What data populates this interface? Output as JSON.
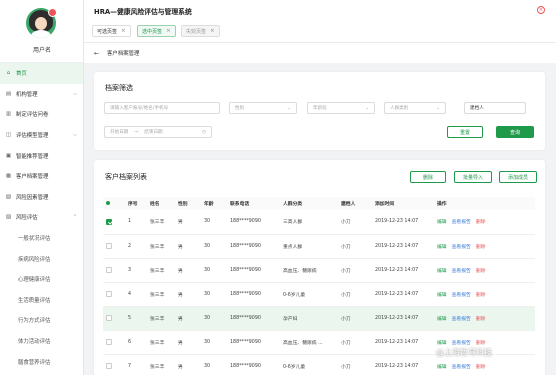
{
  "sidebar": {
    "username": "用户名",
    "menu": [
      {
        "label": "首页",
        "icon": "home-icon",
        "glyph": "⌂",
        "active": true,
        "arrow": ""
      },
      {
        "label": "机构管理",
        "icon": "building-icon",
        "glyph": "▤",
        "active": false,
        "arrow": "⌵"
      },
      {
        "label": "制定评估问卷",
        "icon": "document-icon",
        "glyph": "▥",
        "active": false,
        "arrow": ""
      },
      {
        "label": "评估模型管理",
        "icon": "model-icon",
        "glyph": "◫",
        "active": false,
        "arrow": "⌵"
      },
      {
        "label": "智能推荐管理",
        "icon": "recommend-icon",
        "glyph": "▣",
        "active": false,
        "arrow": ""
      },
      {
        "label": "客户档案管理",
        "icon": "archive-icon",
        "glyph": "▦",
        "active": false,
        "arrow": ""
      },
      {
        "label": "风险因素管理",
        "icon": "risk-factor-icon",
        "glyph": "▧",
        "active": false,
        "arrow": ""
      },
      {
        "label": "风险评估",
        "icon": "risk-assess-icon",
        "glyph": "▨",
        "active": false,
        "arrow": "⌃"
      }
    ],
    "submenu": [
      "一般状况评估",
      "疾病风险评估",
      "心理健康评估",
      "生活质量评估",
      "行为方式评估",
      "体力活动评估",
      "膳食营养评估"
    ]
  },
  "header": {
    "title": "HRA—健康风险评估与管理系统",
    "close_glyph": "×",
    "tabs": [
      {
        "label": "可选页签",
        "state": "normal"
      },
      {
        "label": "选中页签",
        "state": "selected"
      },
      {
        "label": "失效页签",
        "state": "disabled"
      }
    ],
    "tab_close_glyph": "×"
  },
  "breadcrumb": {
    "back_glyph": "←",
    "label": "客户档案管理"
  },
  "filter": {
    "title": "档案筛选",
    "search_placeholder": "请输入客户账号/姓名/手机号",
    "gender_placeholder": "性别",
    "age_placeholder": "年龄段",
    "category_placeholder": "人群类别",
    "creator_value": "建档人",
    "start_placeholder": "开始日期",
    "range_sep": "→",
    "end_placeholder": "结束日期",
    "reset_label": "重置",
    "query_label": "查询",
    "chevron": "⌄",
    "calendar_glyph": "◷"
  },
  "list": {
    "title": "客户档案列表",
    "delete_label": "删除",
    "import_label": "批量导入",
    "add_label": "添加成员",
    "columns": [
      "",
      "序号",
      "姓名",
      "性别",
      "年龄",
      "联系电话",
      "人群分类",
      "建档人",
      "添加时间",
      "操作"
    ],
    "actions": {
      "edit": "编辑",
      "report": "查看报告",
      "delete": "删除"
    },
    "rows": [
      {
        "checked": true,
        "no": "1",
        "name": "张三丰",
        "gender": "男",
        "age": "30",
        "phone": "188****9090",
        "category": "三高人群",
        "creator": "小刀",
        "time": "2019-12-23 14:07",
        "highlight": false
      },
      {
        "checked": false,
        "no": "2",
        "name": "张三丰",
        "gender": "男",
        "age": "30",
        "phone": "188****9090",
        "category": "重点人群",
        "creator": "小刀",
        "time": "2019-12-23 14:07",
        "highlight": false
      },
      {
        "checked": false,
        "no": "3",
        "name": "张三丰",
        "gender": "男",
        "age": "30",
        "phone": "188****9090",
        "category": "高血压、糖尿病",
        "creator": "小刀",
        "time": "2019-12-23 14:07",
        "highlight": false
      },
      {
        "checked": false,
        "no": "4",
        "name": "张三丰",
        "gender": "男",
        "age": "30",
        "phone": "188****9090",
        "category": "0-6岁儿童",
        "creator": "小刀",
        "time": "2019-12-23 14:07",
        "highlight": false
      },
      {
        "checked": false,
        "no": "5",
        "name": "张三丰",
        "gender": "男",
        "age": "30",
        "phone": "188****9090",
        "category": "孕产妇",
        "creator": "小刀",
        "time": "2019-12-23 14:07",
        "highlight": true
      },
      {
        "checked": false,
        "no": "6",
        "name": "张三丰",
        "gender": "男",
        "age": "30",
        "phone": "188****9090",
        "category": "高血压、糖尿病 ...",
        "creator": "小刀",
        "time": "2019-12-23 14:07",
        "highlight": false
      },
      {
        "checked": false,
        "no": "7",
        "name": "张三丰",
        "gender": "男",
        "age": "30",
        "phone": "188****9090",
        "category": "0-6岁儿童",
        "creator": "小刀",
        "time": "2019-12-23 14:07",
        "highlight": false
      }
    ]
  },
  "watermark": "@上海哲寻科技"
}
